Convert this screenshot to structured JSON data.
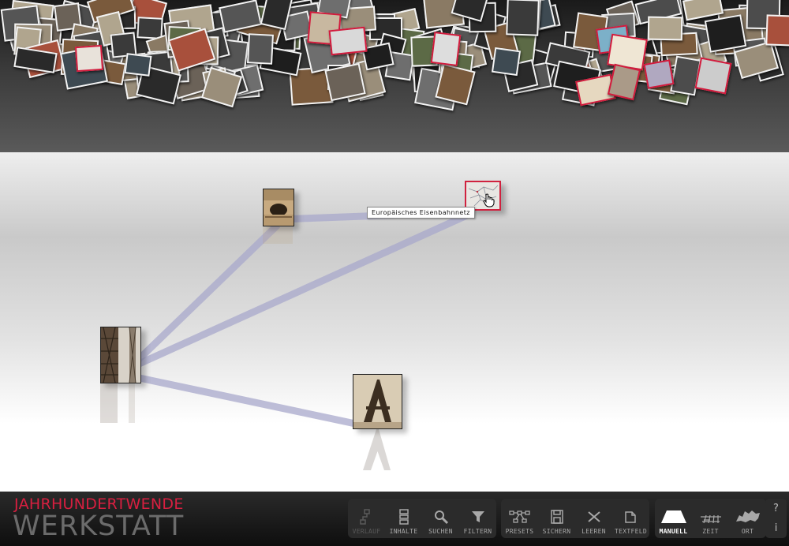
{
  "app": {
    "logo_line1": "JAHRHUNDERTWENDE",
    "logo_line2": "WERKSTATT"
  },
  "workspace": {
    "tooltip": "Europäisches Eisenbahnnetz",
    "link_color": "#a9a9cc"
  },
  "toolbar": {
    "group1": [
      {
        "label": "VERLAUF",
        "icon": "history-icon",
        "state": "disabled"
      },
      {
        "label": "INHALTE",
        "icon": "contents-icon",
        "state": "normal"
      },
      {
        "label": "SUCHEN",
        "icon": "search-icon",
        "state": "normal"
      },
      {
        "label": "FILTERN",
        "icon": "filter-icon",
        "state": "normal"
      }
    ],
    "group2": [
      {
        "label": "PRESETS",
        "icon": "presets-icon",
        "state": "normal"
      },
      {
        "label": "SICHERN",
        "icon": "save-icon",
        "state": "normal"
      },
      {
        "label": "LEEREN",
        "icon": "clear-icon",
        "state": "normal"
      },
      {
        "label": "TEXTFELD",
        "icon": "textfield-icon",
        "state": "normal"
      }
    ],
    "group3": [
      {
        "label": "MANUELL",
        "icon": "manual-icon",
        "state": "active"
      },
      {
        "label": "ZEIT",
        "icon": "time-icon",
        "state": "normal"
      },
      {
        "label": "ORT",
        "icon": "map-icon",
        "state": "normal"
      }
    ],
    "help_label": "?",
    "info_label": "i"
  },
  "colors": {
    "accent": "#d81f40",
    "toolbar_bg": "#2b2b2b"
  }
}
